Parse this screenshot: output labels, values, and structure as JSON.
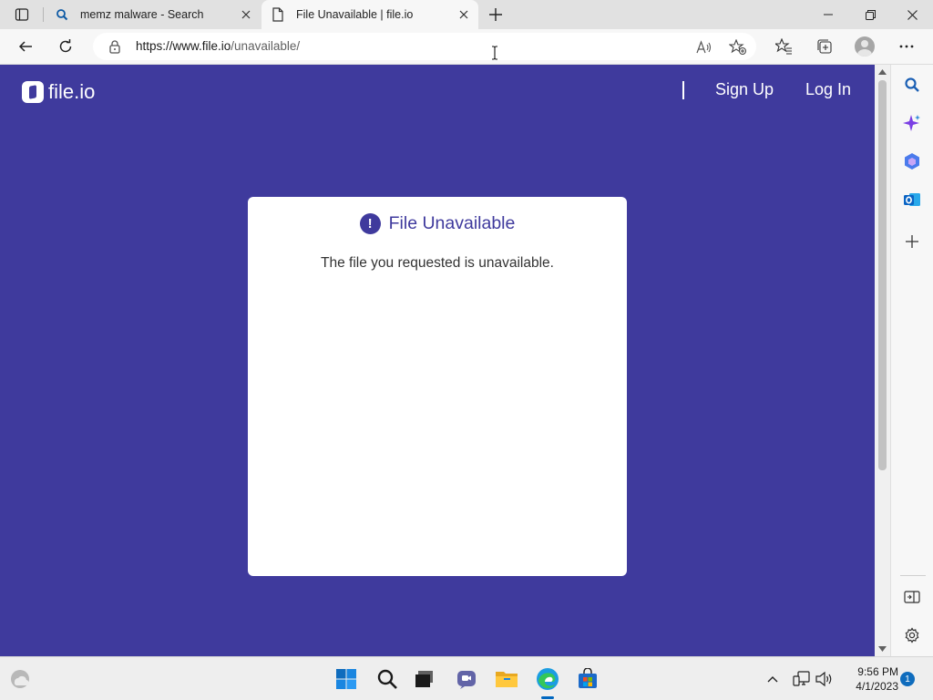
{
  "browser": {
    "tabs": [
      {
        "title": "memz malware - Search",
        "icon": "search-icon",
        "active": false
      },
      {
        "title": "File Unavailable | file.io",
        "icon": "page-icon",
        "active": true
      }
    ],
    "address": {
      "url_host": "https://www.file.io",
      "url_path": "/unavailable/"
    }
  },
  "page": {
    "brand": "file.io",
    "nav": {
      "signup": "Sign Up",
      "login": "Log In"
    },
    "card": {
      "title": "File Unavailable",
      "alert_glyph": "!",
      "message": "The file you requested is unavailable."
    },
    "colors": {
      "background": "#3f3a9d",
      "card": "#ffffff",
      "title": "#3f3a9d"
    }
  },
  "sidebar": {
    "items": [
      "search-icon",
      "copilot-icon",
      "office-icon",
      "outlook-icon",
      "add-icon",
      "split-screen-icon",
      "settings-icon"
    ]
  },
  "taskbar": {
    "apps": [
      "weather-icon",
      "start-icon",
      "search-icon",
      "task-view-icon",
      "chat-icon",
      "file-explorer-icon",
      "edge-icon",
      "store-icon"
    ],
    "time": "9:56 PM",
    "date": "4/1/2023",
    "notification_count": "1"
  }
}
